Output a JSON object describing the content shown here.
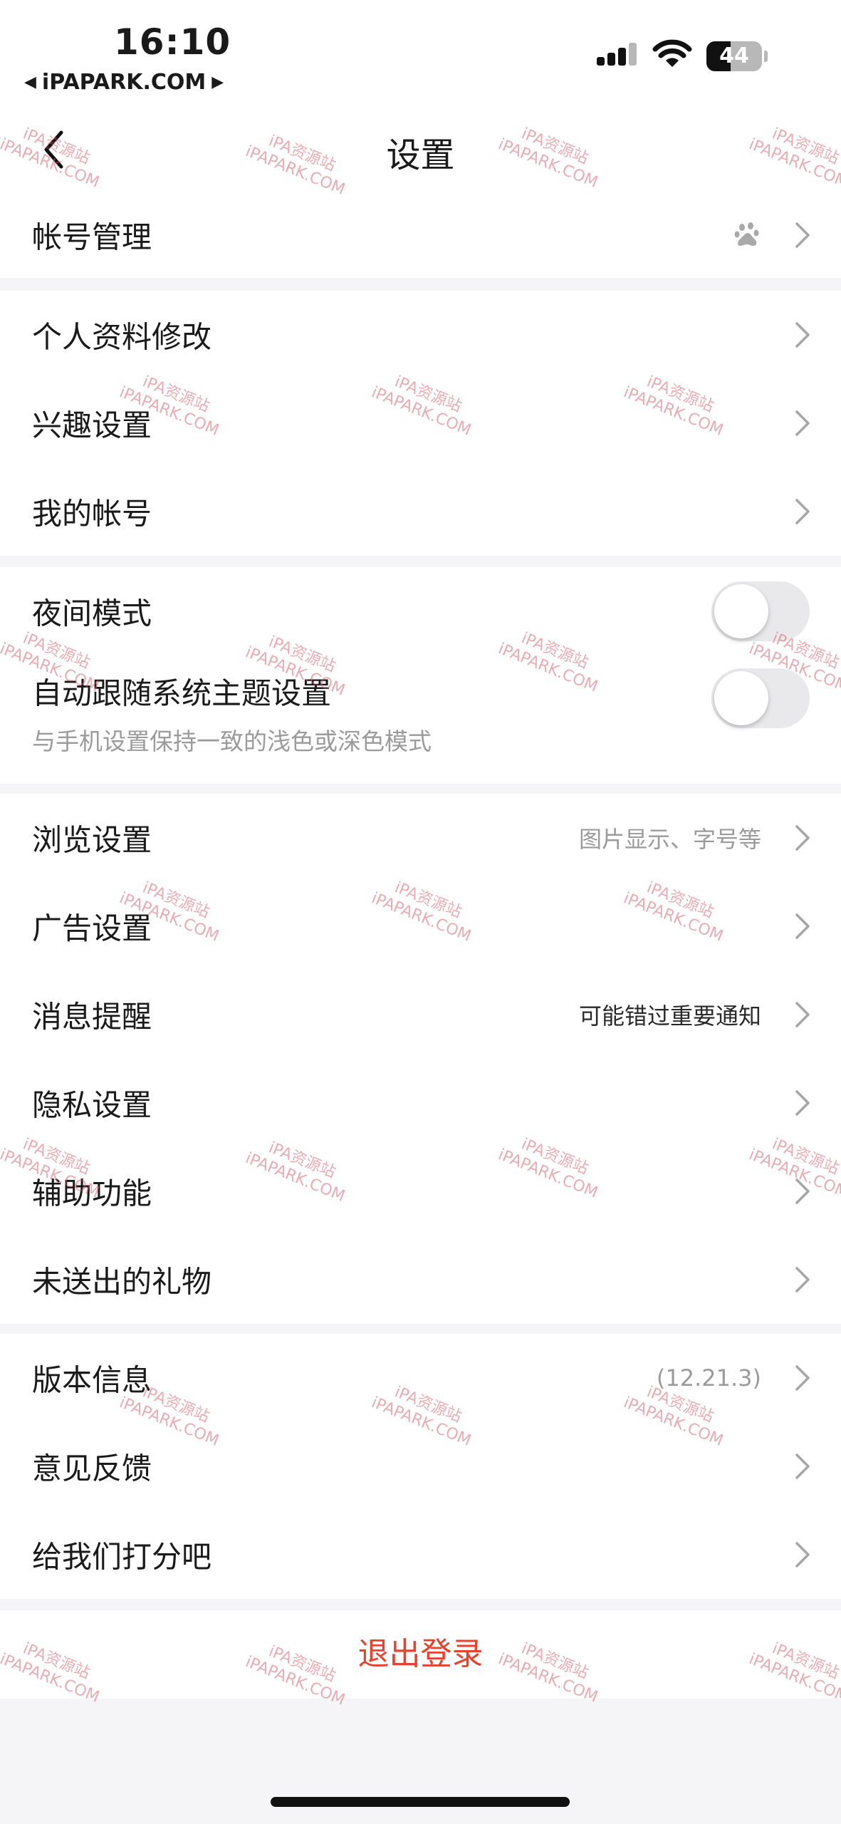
{
  "status_bar": {
    "time": "16:10",
    "carrier": "iPAPARK.COM",
    "battery_level": "44",
    "battery_fraction": 0.44
  },
  "nav": {
    "title": "设置"
  },
  "groups": [
    {
      "rows": [
        {
          "label": "帐号管理",
          "icon": "baidu-paw-icon"
        }
      ]
    },
    {
      "rows": [
        {
          "label": "个人资料修改"
        },
        {
          "label": "兴趣设置"
        },
        {
          "label": "我的帐号"
        }
      ]
    },
    {
      "rows": [
        {
          "label": "夜间模式",
          "toggle": false
        },
        {
          "label": "自动跟随系统主题设置",
          "subtitle": "与手机设置保持一致的浅色或深色模式",
          "toggle": false
        }
      ]
    },
    {
      "rows": [
        {
          "label": "浏览设置",
          "value": "图片显示、字号等"
        },
        {
          "label": "广告设置"
        },
        {
          "label": "消息提醒",
          "value": "可能错过重要通知"
        },
        {
          "label": "隐私设置"
        },
        {
          "label": "辅助功能"
        },
        {
          "label": "未送出的礼物"
        }
      ]
    },
    {
      "rows": [
        {
          "label": "版本信息",
          "value": "(12.21.3)"
        },
        {
          "label": "意见反馈"
        },
        {
          "label": "给我们打分吧"
        }
      ]
    }
  ],
  "logout": {
    "label": "退出登录",
    "color": "#e8412c"
  },
  "watermark": {
    "line1": "iPA资源站",
    "line2": "iPAPARK.COM"
  },
  "colors": {
    "background": "#f5f5f7",
    "toggle_off": "#e9e9eb",
    "secondary_text": "#9b9b9b"
  }
}
